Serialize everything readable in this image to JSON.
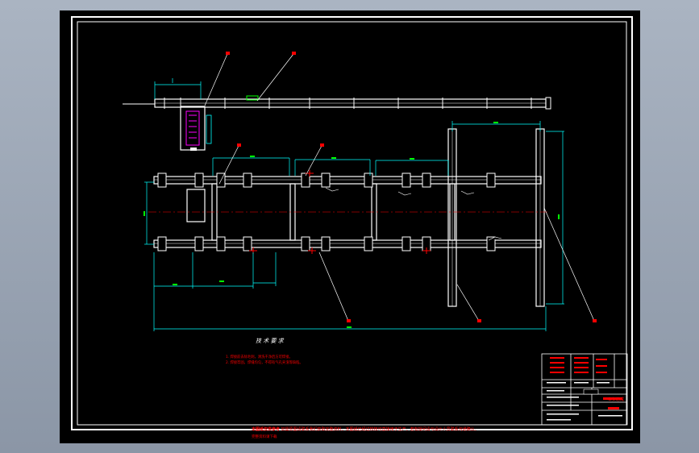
{
  "window": {
    "background_colors": [
      "#aab4c2",
      "#8b96a6"
    ],
    "canvas_color": "#000000"
  },
  "drawing": {
    "frame_color": "#ffffff",
    "frame_colors": {
      "outer": "#ffffff",
      "inner": "#ffffff"
    },
    "part_color": "#ffffff",
    "dimension_color": "#00ffff",
    "centerline_color": "#ff0000",
    "hatch_color": "#ff00ff",
    "dimension_text_color": "#00ff00",
    "tech_requirements": {
      "title": "技 术 要 求",
      "items": [
        "1. 焊接前去除毛刺，清洗干净后方可焊接。",
        "2. 焊接牢固，焊缝均匀，不得有气孔夹渣等缺陷。"
      ]
    },
    "bottom_notice": {
      "line1_head": "本图纸仅供参考",
      "line1_body": "如需原图请联系我们获取完整资料，本图纸已经过校核可直接用于生产，若有疑问请与设计人员联系沟通确认。",
      "line2": "完整资料请下载"
    },
    "title_block": {
      "drawing_title": "车架总成"
    }
  }
}
